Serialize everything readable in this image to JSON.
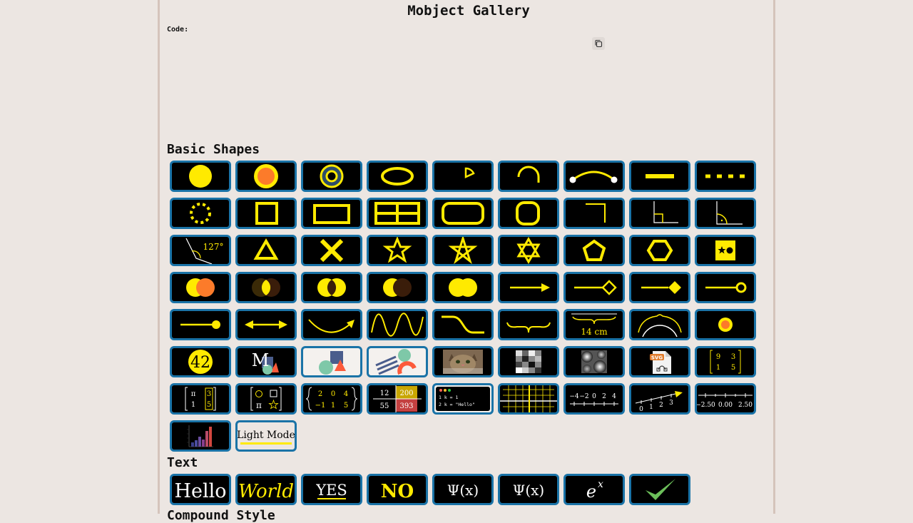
{
  "page": {
    "title": "Mobject Gallery",
    "code_label": "Code:",
    "copy_icon": "copy-icon"
  },
  "sections": {
    "basic": {
      "title": "Basic Shapes"
    },
    "text": {
      "title": "Text"
    },
    "next": {
      "title": "Compound Style"
    }
  },
  "tiles": {
    "angle_value": "127°",
    "circled_number": "42",
    "tex_letter": "M",
    "svg_badge": "SVG",
    "matrix1": [
      "9",
      "3",
      "1",
      "5"
    ],
    "matrix2": [
      "π",
      "3",
      "1",
      "5"
    ],
    "matrix3_sym": "π",
    "matrix4": [
      "2",
      "0",
      "4",
      "−1",
      "1",
      "5"
    ],
    "table": [
      "12",
      "200",
      "55",
      "393"
    ],
    "code_lines": [
      "1  k = 1",
      "2  k = \"Hello\""
    ],
    "numberline1": [
      "−4",
      "−2",
      "0",
      "2",
      "4"
    ],
    "numberline2": [
      "0",
      "1",
      "2",
      "3"
    ],
    "numberline3": [
      "−2.50",
      "0.00",
      "2.50"
    ],
    "brace_label": "14 cm",
    "light_mode": "Light Mode",
    "hello": "Hello",
    "world": "World",
    "yes": "YES",
    "no": "NO",
    "psi1": "Ψ(x)",
    "psi2": "Ψ(x)",
    "exp_base": "e",
    "exp_sup": "x"
  },
  "colors": {
    "accent": "#ffea00",
    "tile_border": "#1a73a7",
    "tile_bg": "#000000",
    "orange": "#fc7b2a",
    "brown": "#3a1d0a"
  }
}
